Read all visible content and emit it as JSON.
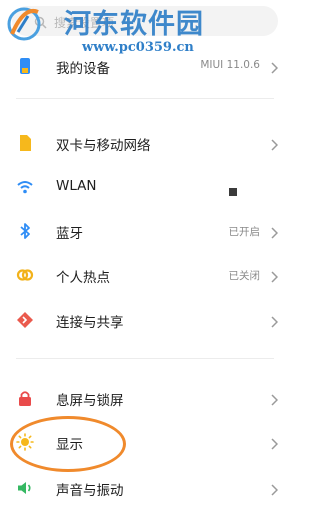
{
  "search": {
    "placeholder": "搜索设置项"
  },
  "watermark": {
    "title": "河东软件园",
    "url": "www.pc0359.cn"
  },
  "device": {
    "label": "我的设备",
    "value": "MIUI 11.0.6",
    "icon": "phone-icon"
  },
  "network": [
    {
      "label": "双卡与移动网络",
      "value": "",
      "icon": "sim-card-icon"
    },
    {
      "label": "WLAN",
      "value": "",
      "icon": "wifi-icon"
    },
    {
      "label": "蓝牙",
      "value": "已开启",
      "icon": "bluetooth-icon"
    },
    {
      "label": "个人热点",
      "value": "已关闭",
      "icon": "hotspot-icon"
    },
    {
      "label": "连接与共享",
      "value": "",
      "icon": "connection-share-icon"
    }
  ],
  "system": [
    {
      "label": "息屏与锁屏",
      "value": "",
      "icon": "lock-icon"
    },
    {
      "label": "显示",
      "value": "",
      "icon": "display-sun-icon"
    },
    {
      "label": "声音与振动",
      "value": "",
      "icon": "speaker-icon"
    }
  ],
  "colors": {
    "accent_orange": "#f08a2c",
    "watermark_blue": "#2f7fc8",
    "sim_yellow": "#f6b81c",
    "wifi_blue": "#2f8df5",
    "hotspot_yellow": "#f2b21b",
    "share_red": "#ea5a4d",
    "lock_red": "#e94b4b",
    "sound_green": "#35b862"
  }
}
